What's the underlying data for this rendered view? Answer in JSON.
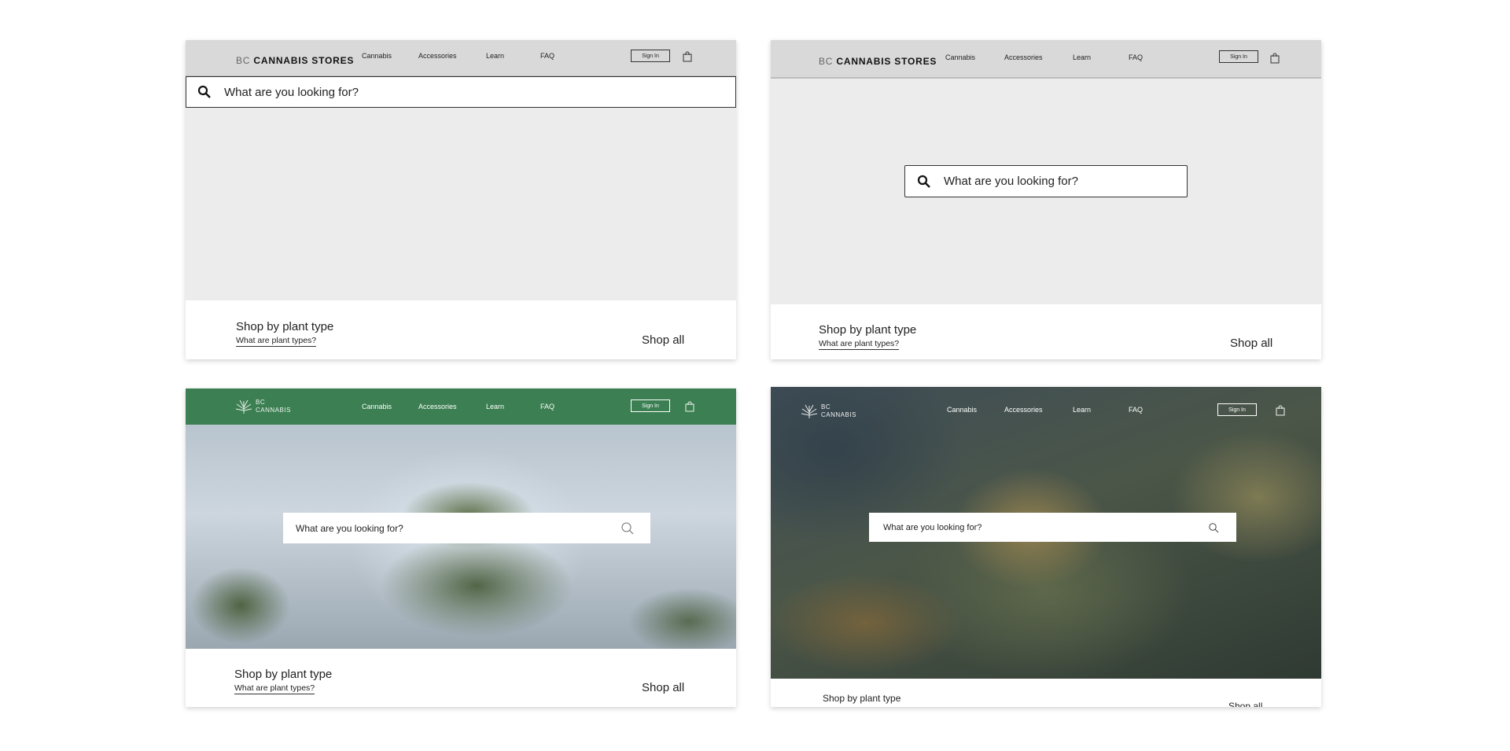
{
  "colors": {
    "wire_gray": "#ececec",
    "wire_nav": "#d9d9d9",
    "brand_green": "#3b7f52",
    "text": "#222222",
    "white": "#ffffff"
  },
  "logo_wire": {
    "prefix": "BC",
    "word1": "CANNABIS",
    "word2": "STORES"
  },
  "logo_brand": {
    "line1": "BC",
    "line2": "CANNABIS"
  },
  "nav": {
    "links": [
      "Cannabis",
      "Accessories",
      "Learn",
      "FAQ"
    ],
    "sign_in": "Sign In",
    "cart_icon": "shopping-bag-icon"
  },
  "search": {
    "placeholder": "What are you looking for?",
    "icon": "search-icon"
  },
  "bottom": {
    "shop_by_type": "Shop by plant type",
    "plant_types_link": "What are plant types?",
    "shop_all": "Shop all"
  }
}
